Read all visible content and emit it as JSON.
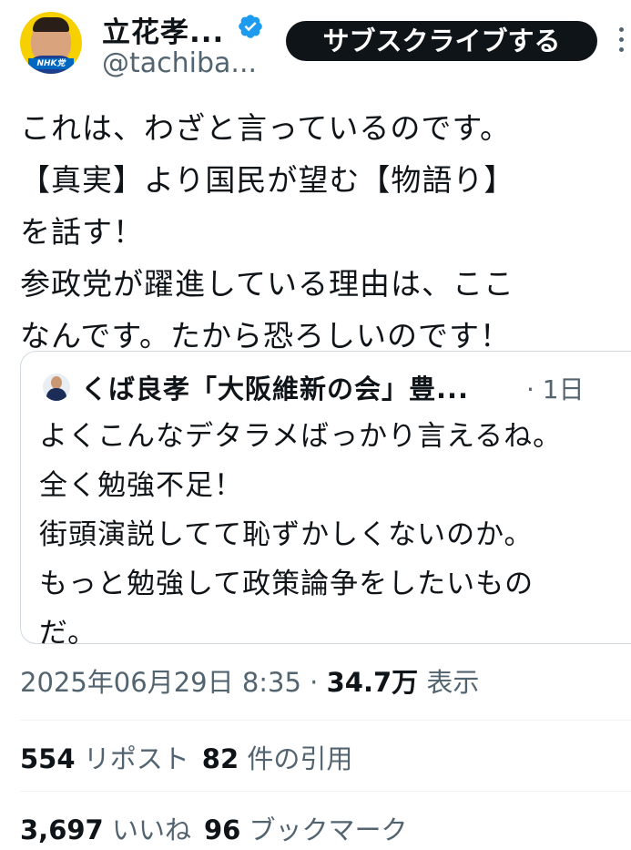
{
  "author": {
    "display_name": "立花孝...",
    "handle": "@tachiba...",
    "avatar_badge": "NHK党",
    "verified_color": "#1d9bf0"
  },
  "actions": {
    "subscribe_label": "サブスクライブする"
  },
  "tweet": {
    "lines": [
      "これは、わざと言っているのです。",
      "【真実】より国民が望む【物語り】",
      "を話す！",
      "参政党が躍進している理由は、ここ",
      "なんです。たから恐ろしいのです！"
    ]
  },
  "quoted": {
    "author": "くば良孝「大阪維新の会」豊...",
    "time": "· 1日",
    "lines": [
      "よくこんなデタラメばっかり言えるね。",
      "全く勉強不足！",
      "街頭演説してて恥ずかしくないのか。",
      "もっと勉強して政策論争をしたいもの",
      "だ。"
    ]
  },
  "meta": {
    "timestamp": "2025年06月29日 8:35 · ",
    "views": "34.7万",
    "views_label": " 表示"
  },
  "stats": {
    "reposts": "554",
    "reposts_label": " リポスト",
    "quotes": "82",
    "quotes_label": " 件の引用",
    "likes": "3,697",
    "likes_label": " いいね",
    "bookmarks": "96",
    "bookmarks_label": " ブックマーク"
  }
}
